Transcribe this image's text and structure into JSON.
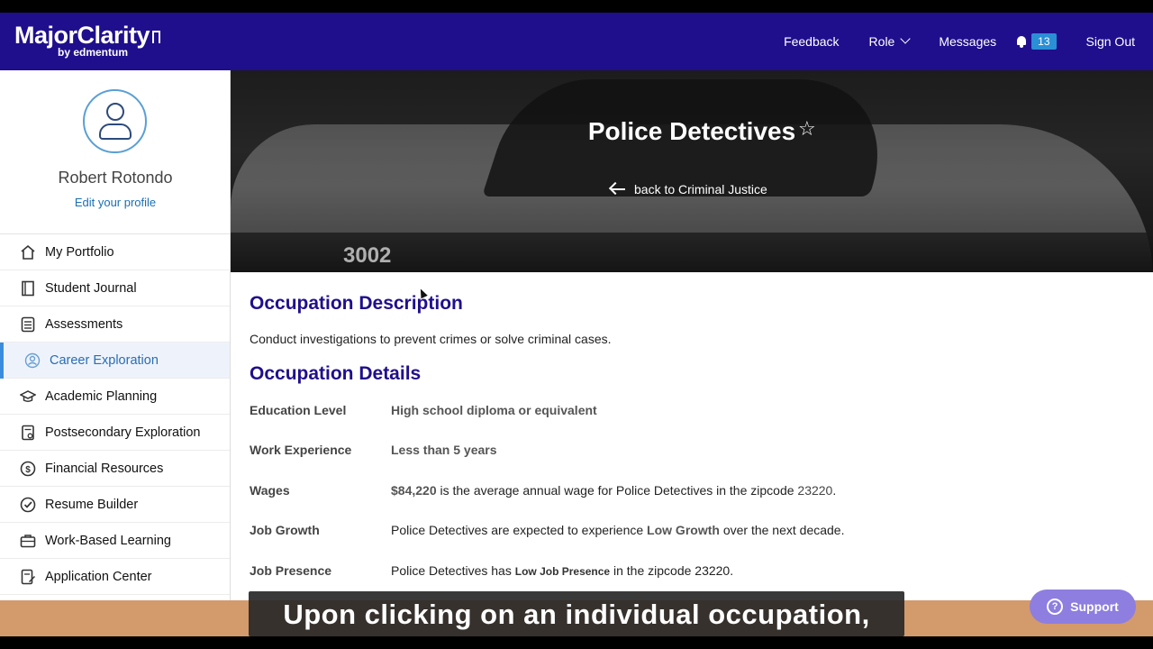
{
  "header": {
    "logo_main": "MajorClarity",
    "logo_sub": "by edmentum",
    "nav": {
      "feedback": "Feedback",
      "role": "Role",
      "messages": "Messages",
      "notifications_count": "13",
      "sign_out": "Sign Out"
    }
  },
  "sidebar": {
    "profile_name": "Robert Rotondo",
    "edit_profile": "Edit your profile",
    "items": [
      {
        "label": "My Portfolio",
        "icon": "home-icon"
      },
      {
        "label": "Student Journal",
        "icon": "journal-icon"
      },
      {
        "label": "Assessments",
        "icon": "checklist-icon"
      },
      {
        "label": "Career Exploration",
        "icon": "person-circle-icon",
        "active": true
      },
      {
        "label": "Academic Planning",
        "icon": "graduation-cap-icon"
      },
      {
        "label": "Postsecondary Exploration",
        "icon": "document-icon"
      },
      {
        "label": "Financial Resources",
        "icon": "dollar-icon"
      },
      {
        "label": "Resume Builder",
        "icon": "check-circle-icon"
      },
      {
        "label": "Work-Based Learning",
        "icon": "briefcase-icon"
      },
      {
        "label": "Application Center",
        "icon": "edit-doc-icon"
      }
    ]
  },
  "hero": {
    "title": "Police Detectives",
    "back_link": "back to Criminal Justice",
    "image_text": "3002"
  },
  "occupation": {
    "description_title": "Occupation Description",
    "description": "Conduct investigations to prevent crimes or solve criminal cases.",
    "details_title": "Occupation Details",
    "details": {
      "education": {
        "label": "Education Level",
        "value": "High school diploma or equivalent"
      },
      "experience": {
        "label": "Work Experience",
        "value": "Less than 5 years"
      },
      "wages": {
        "label": "Wages",
        "amount": "$84,220",
        "text": " is the average annual wage for Police Detectives in the zipcode ",
        "zip": "23220",
        "end": "."
      },
      "growth": {
        "label": "Job Growth",
        "pre": "Police Detectives are expected to experience ",
        "level": "Low Growth",
        "post": " over the next decade."
      },
      "presence": {
        "label": "Job Presence",
        "pre": "Police Detectives has ",
        "level": "Low Job Presence",
        "mid": " in the zipcode ",
        "zip": "23220",
        "end": "."
      }
    }
  },
  "caption": "Upon clicking on an individual occupation,",
  "support": "Support",
  "colors": {
    "brand": "#1f0f8c",
    "accent": "#2b8fd6",
    "caption_bar": "#d39a6c",
    "support": "#8d7ee0"
  }
}
